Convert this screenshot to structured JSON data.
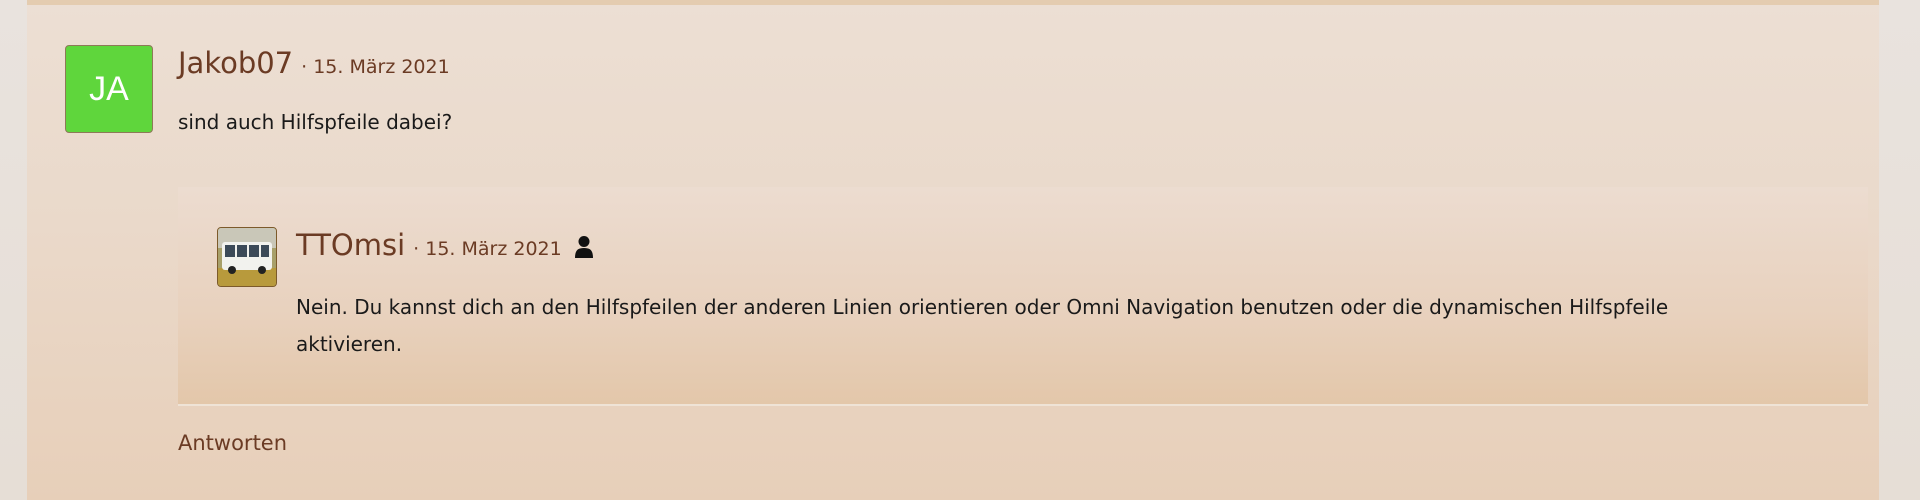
{
  "comment": {
    "avatar_initials": "JA",
    "avatar_color": "#5fd63c",
    "username": "Jakob07",
    "date": "· 15. März 2021",
    "text": "sind auch Hilfspfeile dabei?"
  },
  "reply": {
    "avatar_image": "bus-avatar",
    "username": "TTOmsi",
    "date": "· 15. März 2021",
    "user_badge_icon": "user-icon",
    "text": "Nein. Du kannst dich an den Hilfspfeilen der anderen Linien orientieren oder Omni Navigation benutzen oder die dynamischen Hilfspfeile aktivieren."
  },
  "actions": {
    "reply_label": "Antworten"
  },
  "colors": {
    "accent_text": "#6b3b24",
    "body_text": "#1a1a1a"
  }
}
